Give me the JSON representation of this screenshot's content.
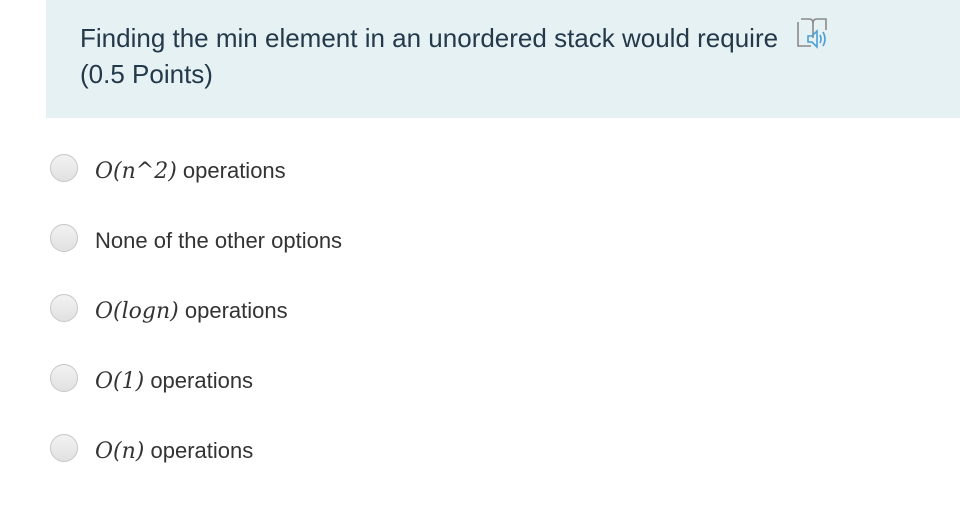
{
  "question": {
    "title": "Finding the min element in an unordered stack would require",
    "points": "(0.5 Points)",
    "reader_icon": "immersive-reader-icon"
  },
  "options": [
    {
      "math": "O(n^2)",
      "label": " operations"
    },
    {
      "math": "",
      "label": "None of the other options"
    },
    {
      "math": "O(logn)",
      "label": " operations"
    },
    {
      "math": "O(1)",
      "label": " operations"
    },
    {
      "math": "O(n)",
      "label": " operations"
    }
  ],
  "colors": {
    "header_bg": "#e5f1f3",
    "title": "#24394a",
    "icon_blue": "#4aa0d8"
  }
}
